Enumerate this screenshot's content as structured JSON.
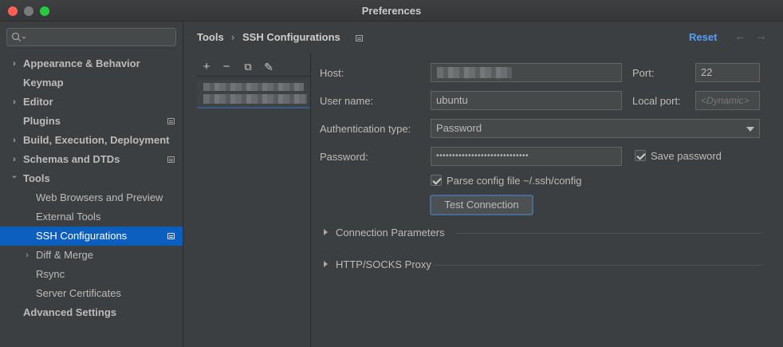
{
  "window": {
    "title": "Preferences"
  },
  "search": {
    "placeholder": ""
  },
  "sidebar": {
    "items": [
      {
        "label": "Appearance & Behavior",
        "bold": true,
        "expand": "right",
        "indent": 0
      },
      {
        "label": "Keymap",
        "bold": true,
        "expand": "",
        "indent": 0
      },
      {
        "label": "Editor",
        "bold": true,
        "expand": "right",
        "indent": 0
      },
      {
        "label": "Plugins",
        "bold": true,
        "expand": "",
        "indent": 0,
        "project_icon": true
      },
      {
        "label": "Build, Execution, Deployment",
        "bold": true,
        "expand": "right",
        "indent": 0
      },
      {
        "label": "Schemas and DTDs",
        "bold": true,
        "expand": "right",
        "indent": 0,
        "project_icon": true
      },
      {
        "label": "Tools",
        "bold": true,
        "expand": "down",
        "indent": 0
      },
      {
        "label": "Web Browsers and Preview",
        "bold": false,
        "expand": "",
        "indent": 1
      },
      {
        "label": "External Tools",
        "bold": false,
        "expand": "",
        "indent": 1
      },
      {
        "label": "SSH Configurations",
        "bold": false,
        "expand": "",
        "indent": 1,
        "selected": true,
        "project_icon": true
      },
      {
        "label": "Diff & Merge",
        "bold": false,
        "expand": "right",
        "indent": 1
      },
      {
        "label": "Rsync",
        "bold": false,
        "expand": "",
        "indent": 1
      },
      {
        "label": "Server Certificates",
        "bold": false,
        "expand": "",
        "indent": 1
      },
      {
        "label": "Advanced Settings",
        "bold": true,
        "expand": "",
        "indent": 0
      }
    ]
  },
  "header": {
    "breadcrumb_parent": "Tools",
    "breadcrumb_sep": "›",
    "breadcrumb_current": "SSH Configurations",
    "reset_label": "Reset",
    "back_glyph": "←",
    "forward_glyph": "→"
  },
  "list_toolbar": {
    "add": "+",
    "remove": "−",
    "copy": "⧉",
    "edit": "✎"
  },
  "form": {
    "host_label": "Host:",
    "host_value": "",
    "port_label": "Port:",
    "port_value": "22",
    "username_label": "User name:",
    "username_value": "ubuntu",
    "local_port_label": "Local port:",
    "local_port_placeholder": "<Dynamic>",
    "auth_type_label": "Authentication type:",
    "auth_type_value": "Password",
    "password_label": "Password:",
    "password_mask": "•••••••••••••••••••••••••••••",
    "save_password_label": "Save password",
    "save_password_checked": true,
    "parse_config_label": "Parse config file ~/.ssh/config",
    "parse_config_checked": true,
    "test_connection_label": "Test Connection"
  },
  "sections": [
    {
      "title": "Connection Parameters",
      "collapsed": true
    },
    {
      "title": "HTTP/SOCKS Proxy",
      "collapsed": true
    }
  ],
  "colors": {
    "selection": "#0d5fbf",
    "link": "#589df6",
    "background": "#3c3f41"
  }
}
